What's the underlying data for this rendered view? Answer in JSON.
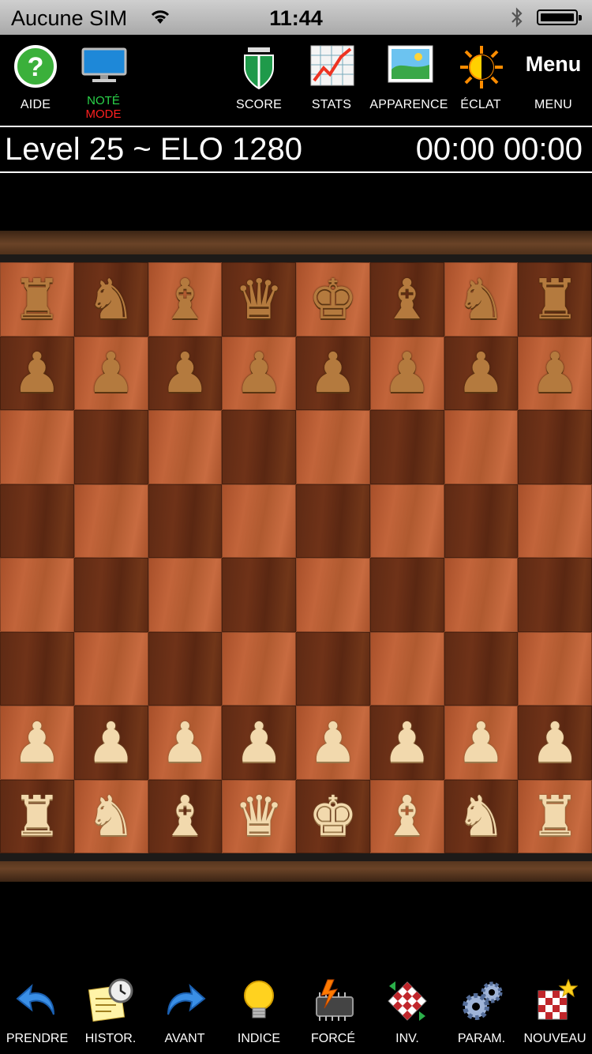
{
  "status": {
    "carrier": "Aucune SIM",
    "time": "11:44"
  },
  "toolbar": {
    "aide": "AIDE",
    "note_line1": "NOTÉ",
    "note_line2": "MODE",
    "score": "SCORE",
    "stats": "STATS",
    "apparence": "APPARENCE",
    "eclat": "ÉCLAT",
    "menu_big": "Menu",
    "menu": "MENU"
  },
  "info": {
    "level": "Level 25 ~ ELO 1280",
    "clock": "00:00 00:00"
  },
  "board": {
    "rows": [
      [
        "r",
        "n",
        "b",
        "q",
        "k",
        "b",
        "n",
        "r"
      ],
      [
        "p",
        "p",
        "p",
        "p",
        "p",
        "p",
        "p",
        "p"
      ],
      [
        "",
        "",
        "",
        "",
        "",
        "",
        "",
        ""
      ],
      [
        "",
        "",
        "",
        "",
        "",
        "",
        "",
        ""
      ],
      [
        "",
        "",
        "",
        "",
        "",
        "",
        "",
        ""
      ],
      [
        "",
        "",
        "",
        "",
        "",
        "",
        "",
        ""
      ],
      [
        "P",
        "P",
        "P",
        "P",
        "P",
        "P",
        "P",
        "P"
      ],
      [
        "R",
        "N",
        "B",
        "Q",
        "K",
        "B",
        "N",
        "R"
      ]
    ],
    "glyphs": {
      "r": "♜",
      "n": "♞",
      "b": "♝",
      "q": "♛",
      "k": "♚",
      "p": "♟",
      "R": "♜",
      "N": "♞",
      "B": "♝",
      "Q": "♛",
      "K": "♚",
      "P": "♟"
    }
  },
  "bottom": {
    "prendre": "PRENDRE",
    "histor": "HISTOR.",
    "avant": "AVANT",
    "indice": "INDICE",
    "force": "FORCÉ",
    "inv": "INV.",
    "param": "PARAM.",
    "nouveau": "NOUVEAU"
  },
  "colors": {
    "note_green": "#2bd64a",
    "note_red": "#ff2020",
    "light_square": "#b85c33",
    "dark_square": "#632d16"
  }
}
